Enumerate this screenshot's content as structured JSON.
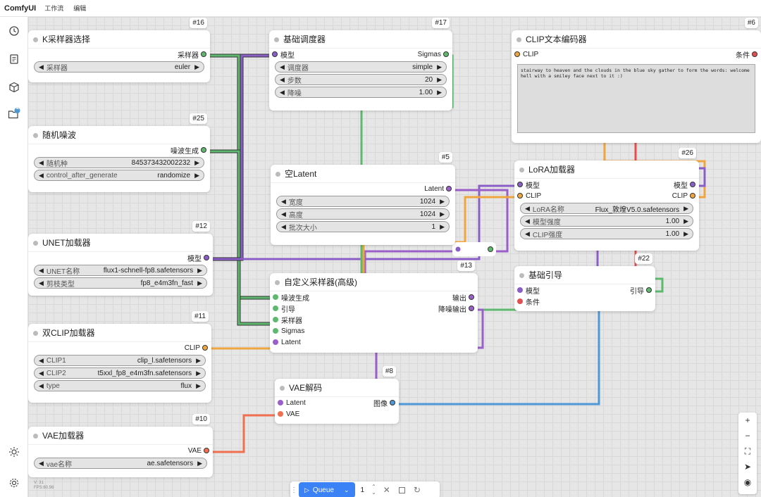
{
  "app": {
    "title": "ComfyUI",
    "menu": [
      "工作流",
      "编辑"
    ]
  },
  "sidebar": {
    "queue_badge": "2",
    "icons": [
      "history-icon",
      "book-icon",
      "cube-icon",
      "folder-icon",
      "sun-icon",
      "settings-icon"
    ]
  },
  "nodes": {
    "n16": {
      "id": "#16",
      "title": "K采样器选择",
      "out": "采样器",
      "w1_label": "采样器",
      "w1_value": "euler"
    },
    "n17": {
      "id": "#17",
      "title": "基础调度器",
      "in": "模型",
      "out": "Sigmas",
      "w1_label": "调度器",
      "w1_value": "simple",
      "w2_label": "步数",
      "w2_value": "20",
      "w3_label": "降噪",
      "w3_value": "1.00"
    },
    "n6": {
      "id": "#6",
      "title": "CLIP文本编码器",
      "in": "CLIP",
      "out": "条件",
      "text": "stairway to heaven and the clouds in the blue sky gather to form the words: welcome hell with a smiley face next to it :)"
    },
    "n25": {
      "id": "#25",
      "title": "随机噪波",
      "out": "噪波生成",
      "w1_label": "随机种",
      "w1_value": "845373432002232",
      "w2_label": "control_after_generate",
      "w2_value": "randomize"
    },
    "n5": {
      "id": "#5",
      "title": "空Latent",
      "out": "Latent",
      "w1_label": "宽度",
      "w1_value": "1024",
      "w2_label": "高度",
      "w2_value": "1024",
      "w3_label": "批次大小",
      "w3_value": "1"
    },
    "n26": {
      "id": "#26",
      "title": "LoRA加载器",
      "in1": "模型",
      "in2": "CLIP",
      "out1": "模型",
      "out2": "CLIP",
      "w1_label": "LoRA名称",
      "w1_value": "Flux_敦煌V5.0.safetensors",
      "w2_label": "模型强度",
      "w2_value": "1.00",
      "w3_label": "CLIP强度",
      "w3_value": "1.00"
    },
    "n12": {
      "id": "#12",
      "title": "UNET加载器",
      "out": "模型",
      "w1_label": "UNET名称",
      "w1_value": "flux1-schnell-fp8.safetensors",
      "w2_label": "剪枝类型",
      "w2_value": "fp8_e4m3fn_fast"
    },
    "n13": {
      "id": "#13",
      "title": "自定义采样器(高级)",
      "in1": "噪波生成",
      "in2": "引导",
      "in3": "采样器",
      "in4": "Sigmas",
      "in5": "Latent",
      "out1": "输出",
      "out2": "降噪输出"
    },
    "n22": {
      "id": "#22",
      "title": "基础引导",
      "in1": "模型",
      "in2": "条件",
      "out": "引导"
    },
    "n11": {
      "id": "#11",
      "title": "双CLIP加载器",
      "out": "CLIP",
      "w1_label": "CLIP1",
      "w1_value": "clip_l.safetensors",
      "w2_label": "CLIP2",
      "w2_value": "t5xxl_fp8_e4m3fn.safetensors",
      "w3_label": "type",
      "w3_value": "flux"
    },
    "n8": {
      "id": "#8",
      "title": "VAE解码",
      "in1": "Latent",
      "in2": "VAE",
      "out": "图像"
    },
    "n10": {
      "id": "#10",
      "title": "VAE加载器",
      "out": "VAE",
      "w1_label": "vae名称",
      "w1_value": "ae.safetensors"
    }
  },
  "queue": {
    "label": "Queue",
    "count": "1"
  },
  "version": {
    "v": "V: 31",
    "fps": "FPS:60.98"
  },
  "colors": {
    "model": "#8a5ec7",
    "clip": "#f0a640",
    "conditioning": "#e05050",
    "latent": "#9a5fc9",
    "sampler": "#5eb96e",
    "vae": "#f07050",
    "image": "#4d98d6",
    "sigmas": "#5eb96e",
    "noise": "#5eb96e",
    "guider": "#5eb96e"
  }
}
